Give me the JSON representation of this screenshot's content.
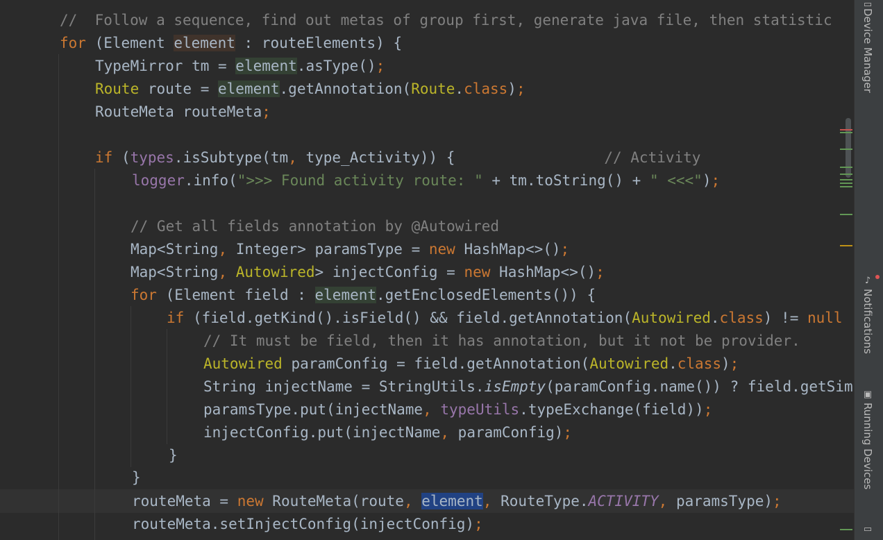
{
  "editor": {
    "lines": [
      [
        {
          "t": "//  Follow a sequence, find out metas of group first, generate java file, then statistic",
          "c": "cmt"
        }
      ],
      [
        {
          "t": "for",
          "c": "kw"
        },
        {
          "t": " (Element "
        },
        {
          "t": "element",
          "c": "hl-write"
        },
        {
          "t": " : routeElements) {"
        }
      ],
      [
        {
          "t": "TypeMirror tm = "
        },
        {
          "t": "element",
          "c": "hl-read"
        },
        {
          "t": ".asType()"
        },
        {
          "t": ";",
          "c": "kw"
        }
      ],
      [
        {
          "t": "Route",
          "c": "ann"
        },
        {
          "t": " route = "
        },
        {
          "t": "element",
          "c": "hl-read"
        },
        {
          "t": ".getAnnotation("
        },
        {
          "t": "Route",
          "c": "ann"
        },
        {
          "t": "."
        },
        {
          "t": "class",
          "c": "kw"
        },
        {
          "t": ")"
        },
        {
          "t": ";",
          "c": "kw"
        }
      ],
      [
        {
          "t": "RouteMeta routeMeta"
        },
        {
          "t": ";",
          "c": "kw"
        }
      ],
      [
        {
          "t": ""
        }
      ],
      [
        {
          "t": "if",
          "c": "kw"
        },
        {
          "t": " ("
        },
        {
          "t": "types",
          "c": "fld"
        },
        {
          "t": ".isSubtype(tm"
        },
        {
          "t": ", ",
          "c": "kw"
        },
        {
          "t": "type_Activity)) {                 "
        },
        {
          "t": "// Activity",
          "c": "cmt"
        }
      ],
      [
        {
          "t": "logger",
          "c": "fld"
        },
        {
          "t": ".info("
        },
        {
          "t": "\">>> Found activity route: \"",
          "c": "str"
        },
        {
          "t": " + tm.toString() + "
        },
        {
          "t": "\" <<<\"",
          "c": "str"
        },
        {
          "t": ")"
        },
        {
          "t": ";",
          "c": "kw"
        }
      ],
      [
        {
          "t": ""
        }
      ],
      [
        {
          "t": "// Get all fields annotation by @Autowired",
          "c": "cmt"
        }
      ],
      [
        {
          "t": "Map<String"
        },
        {
          "t": ", ",
          "c": "kw"
        },
        {
          "t": "Integer> paramsType = "
        },
        {
          "t": "new",
          "c": "kw"
        },
        {
          "t": " HashMap<>()"
        },
        {
          "t": ";",
          "c": "kw"
        }
      ],
      [
        {
          "t": "Map<String"
        },
        {
          "t": ", ",
          "c": "kw"
        },
        {
          "t": "Autowired",
          "c": "ann"
        },
        {
          "t": "> injectConfig = "
        },
        {
          "t": "new",
          "c": "kw"
        },
        {
          "t": " HashMap<>()"
        },
        {
          "t": ";",
          "c": "kw"
        }
      ],
      [
        {
          "t": "for",
          "c": "kw"
        },
        {
          "t": " (Element field : "
        },
        {
          "t": "element",
          "c": "hl-read"
        },
        {
          "t": ".getEnclosedElements()) {"
        }
      ],
      [
        {
          "t": "if",
          "c": "kw"
        },
        {
          "t": " (field.getKind().isField() && field.getAnnotation("
        },
        {
          "t": "Autowired",
          "c": "ann"
        },
        {
          "t": "."
        },
        {
          "t": "class",
          "c": "kw"
        },
        {
          "t": ") != "
        },
        {
          "t": "null",
          "c": "kw"
        }
      ],
      [
        {
          "t": "// It must be field, then it has annotation, but it not be provider.",
          "c": "cmt"
        }
      ],
      [
        {
          "t": "Autowired",
          "c": "ann"
        },
        {
          "t": " paramConfig = field.getAnnotation("
        },
        {
          "t": "Autowired",
          "c": "ann"
        },
        {
          "t": "."
        },
        {
          "t": "class",
          "c": "kw"
        },
        {
          "t": ")"
        },
        {
          "t": ";",
          "c": "kw"
        }
      ],
      [
        {
          "t": "String injectName = StringUtils."
        },
        {
          "t": "isEmpty",
          "c": "it"
        },
        {
          "t": "(paramConfig.name()) ? field.getSimpleName()"
        }
      ],
      [
        {
          "t": "paramsType.put(injectName"
        },
        {
          "t": ", ",
          "c": "kw"
        },
        {
          "t": "typeUtils",
          "c": "fld"
        },
        {
          "t": ".typeExchange(field))"
        },
        {
          "t": ";",
          "c": "kw"
        }
      ],
      [
        {
          "t": "injectConfig.put(injectName"
        },
        {
          "t": ", ",
          "c": "kw"
        },
        {
          "t": "paramConfig)"
        },
        {
          "t": ";",
          "c": "kw"
        }
      ],
      [
        {
          "t": "}"
        }
      ],
      [
        {
          "t": "}"
        }
      ],
      [
        {
          "t": "routeMeta = "
        },
        {
          "t": "new",
          "c": "kw"
        },
        {
          "t": " RouteMeta(route"
        },
        {
          "t": ", ",
          "c": "kw"
        },
        {
          "t": "element",
          "c": "hl-caret"
        },
        {
          "t": ", ",
          "c": "kw"
        },
        {
          "t": "RouteType."
        },
        {
          "t": "ACTIVITY",
          "c": "cst"
        },
        {
          "t": ", ",
          "c": "kw"
        },
        {
          "t": "paramsType)"
        },
        {
          "t": ";",
          "c": "kw"
        }
      ],
      [
        {
          "t": "routeMeta.setInjectConfig(injectConfig)"
        },
        {
          "t": ";",
          "c": "kw"
        }
      ]
    ]
  },
  "tool_windows": {
    "device_manager": "Device Manager",
    "notifications": "Notifications",
    "running_devices": "Running Devices"
  },
  "icons": {
    "device_manager": "device-manager-icon",
    "notifications": "bell-icon",
    "running_devices": "running-devices-icon"
  },
  "colors": {
    "background": "#2b2b2b",
    "keyword": "#cc7832",
    "annotation": "#bbb529",
    "string": "#6a8759",
    "comment": "#808080",
    "field": "#9876aa",
    "selection": "#214283"
  }
}
